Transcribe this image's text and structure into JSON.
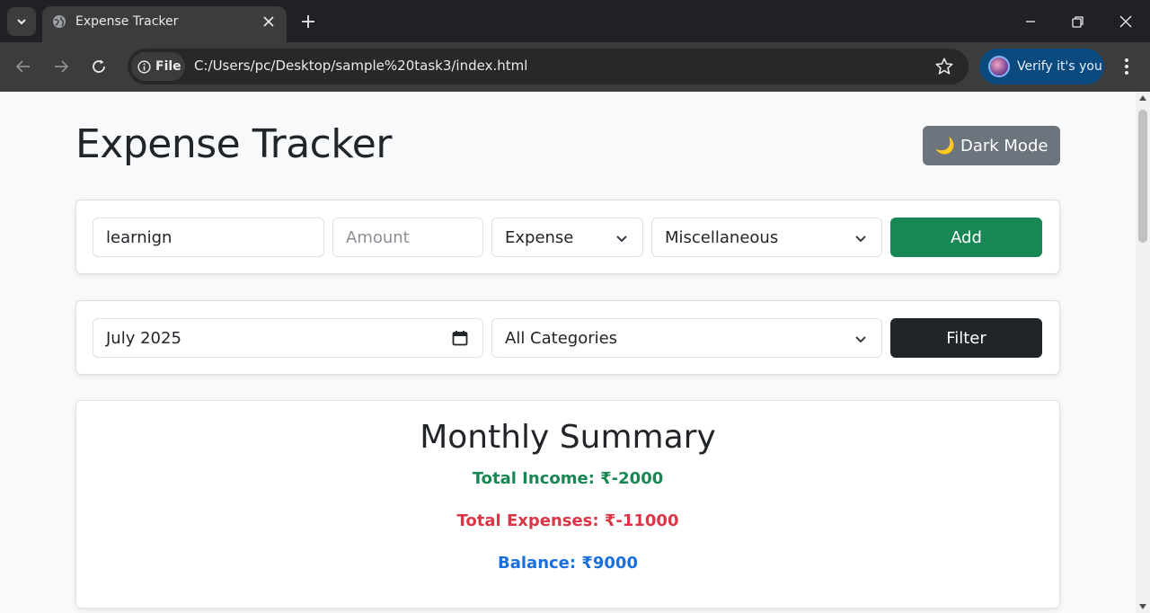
{
  "browser": {
    "tab_title": "Expense Tracker",
    "file_chip": "File",
    "url": "C:/Users/pc/Desktop/sample%20task3/index.html",
    "verify_label": "Verify it's you"
  },
  "app": {
    "title": "Expense Tracker",
    "dark_mode_label": "Dark Mode",
    "dark_mode_icon": "🌙"
  },
  "add_form": {
    "description_value": "learnign",
    "amount_placeholder": "Amount",
    "type_selected": "Expense",
    "category_selected": "Miscellaneous",
    "add_label": "Add"
  },
  "filter_form": {
    "month_value": "July 2025",
    "category_selected": "All Categories",
    "filter_label": "Filter"
  },
  "summary": {
    "title": "Monthly Summary",
    "income": "Total Income: ₹-2000",
    "expenses": "Total Expenses: ₹-11000",
    "balance": "Balance: ₹9000"
  },
  "colors": {
    "income": "#198754",
    "expenses": "#dc3545",
    "balance": "#0d6efd",
    "add_button": "#198754",
    "filter_button": "#212529",
    "dark_mode_button": "#6c757d"
  }
}
